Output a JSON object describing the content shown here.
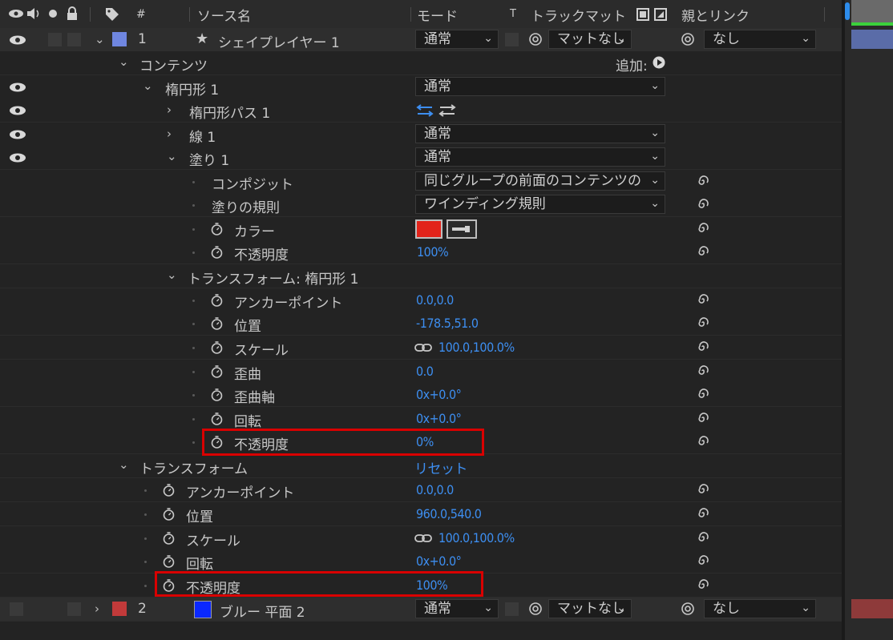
{
  "header": {
    "source_name": "ソース名",
    "mode": "モード",
    "t": "T",
    "track_matte": "トラックマット",
    "parent_link": "親とリンク",
    "hash": "#"
  },
  "layer1": {
    "number": "1",
    "name": "シェイプレイヤー 1",
    "mode": "通常",
    "matte": "マットなし",
    "parent": "なし",
    "label_color": "#6f86e0"
  },
  "contents": {
    "label": "コンテンツ",
    "add_label": "追加:"
  },
  "ellipse": {
    "label": "楕円形 1",
    "mode": "通常",
    "path_label": "楕円形パス 1",
    "stroke_label": "線 1",
    "stroke_mode": "通常",
    "fill_label": "塗り 1",
    "fill_mode": "通常",
    "composite_label": "コンポジット",
    "composite_value": "同じグループの前面のコンテンツの",
    "fill_rule_label": "塗りの規則",
    "fill_rule_value": "ワインディング規則",
    "color_label": "カラー",
    "color_value": "#e2231a",
    "fill_opacity_label": "不透明度",
    "fill_opacity_value": "100%"
  },
  "group_transform": {
    "label": "トランスフォーム: 楕円形 1",
    "anchor_label": "アンカーポイント",
    "anchor_value": "0.0,0.0",
    "position_label": "位置",
    "position_value": "-178.5,51.0",
    "scale_label": "スケール",
    "scale_value": "100.0,100.0%",
    "skew_label": "歪曲",
    "skew_value": "0.0",
    "skew_axis_label": "歪曲軸",
    "skew_axis_value": "0x+0.0°",
    "rotation_label": "回転",
    "rotation_value": "0x+0.0°",
    "opacity_label": "不透明度",
    "opacity_value": "0%"
  },
  "layer_transform": {
    "label": "トランスフォーム",
    "reset_label": "リセット",
    "anchor_label": "アンカーポイント",
    "anchor_value": "0.0,0.0",
    "position_label": "位置",
    "position_value": "960.0,540.0",
    "scale_label": "スケール",
    "scale_value": "100.0,100.0%",
    "rotation_label": "回転",
    "rotation_value": "0x+0.0°",
    "opacity_label": "不透明度",
    "opacity_value": "100%"
  },
  "layer2": {
    "number": "2",
    "name": "ブルー 平面 2",
    "mode": "通常",
    "matte": "マットなし",
    "parent": "なし",
    "label_color": "#c23a3a",
    "swatch_color": "#0a28ff"
  }
}
